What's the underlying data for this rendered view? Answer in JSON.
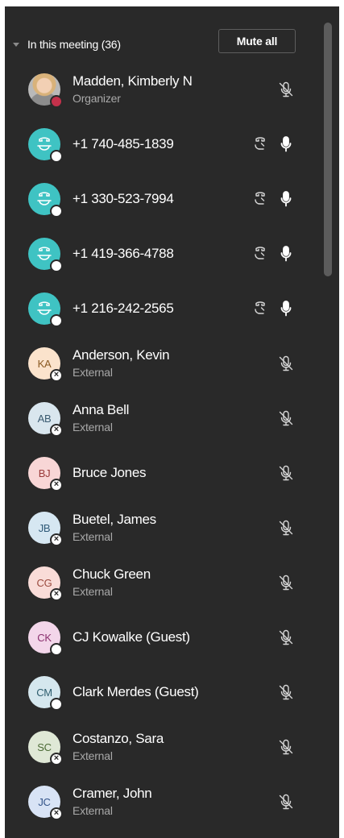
{
  "section": {
    "title": "In this meeting (36)",
    "mute_all_label": "Mute all"
  },
  "participants": [
    {
      "name": "Madden, Kimberly N",
      "subtitle": "Organizer",
      "initials": "",
      "avatar": "photo",
      "avatar_bg": "#b9b9b9",
      "avatar_fg": "#ffffff",
      "status": "busy",
      "mic": "mic-off-icon",
      "phone_icon": false
    },
    {
      "name": "+1 740-485-1839",
      "subtitle": "",
      "initials": "",
      "avatar": "phone",
      "avatar_bg": "#3fc3c3",
      "avatar_fg": "#ffffff",
      "status": "offline",
      "mic": "mic-on-icon",
      "phone_icon": true
    },
    {
      "name": "+1 330-523-7994",
      "subtitle": "",
      "initials": "",
      "avatar": "phone",
      "avatar_bg": "#3fc3c3",
      "avatar_fg": "#ffffff",
      "status": "offline",
      "mic": "mic-on-icon",
      "phone_icon": true
    },
    {
      "name": "+1 419-366-4788",
      "subtitle": "",
      "initials": "",
      "avatar": "phone",
      "avatar_bg": "#3fc3c3",
      "avatar_fg": "#ffffff",
      "status": "offline",
      "mic": "mic-on-icon",
      "phone_icon": true
    },
    {
      "name": "+1 216-242-2565",
      "subtitle": "",
      "initials": "",
      "avatar": "phone",
      "avatar_bg": "#3fc3c3",
      "avatar_fg": "#ffffff",
      "status": "offline",
      "mic": "mic-on-icon",
      "phone_icon": true
    },
    {
      "name": "Anderson, Kevin",
      "subtitle": "External",
      "initials": "KA",
      "avatar": "initials",
      "avatar_bg": "#fbe3cc",
      "avatar_fg": "#8a5a22",
      "status": "external",
      "mic": "mic-off-icon",
      "phone_icon": false
    },
    {
      "name": "Anna Bell",
      "subtitle": "External",
      "initials": "AB",
      "avatar": "initials",
      "avatar_bg": "#d9e6ee",
      "avatar_fg": "#3a5a70",
      "status": "external",
      "mic": "mic-off-icon",
      "phone_icon": false
    },
    {
      "name": "Bruce Jones",
      "subtitle": "",
      "initials": "BJ",
      "avatar": "initials",
      "avatar_bg": "#f8d6d6",
      "avatar_fg": "#9a3b3b",
      "status": "external",
      "mic": "mic-off-icon",
      "phone_icon": false
    },
    {
      "name": "Buetel, James",
      "subtitle": "External",
      "initials": "JB",
      "avatar": "initials",
      "avatar_bg": "#d6e7f2",
      "avatar_fg": "#2f5a78",
      "status": "external",
      "mic": "mic-off-icon",
      "phone_icon": false
    },
    {
      "name": "Chuck Green",
      "subtitle": "External",
      "initials": "CG",
      "avatar": "initials",
      "avatar_bg": "#f9dcd8",
      "avatar_fg": "#9a4a3e",
      "status": "external",
      "mic": "mic-off-icon",
      "phone_icon": false
    },
    {
      "name": "CJ Kowalke (Guest)",
      "subtitle": "",
      "initials": "CK",
      "avatar": "initials",
      "avatar_bg": "#f3d6ea",
      "avatar_fg": "#8a2f6e",
      "status": "offline",
      "mic": "mic-off-icon",
      "phone_icon": false
    },
    {
      "name": "Clark Merdes (Guest)",
      "subtitle": "",
      "initials": "CM",
      "avatar": "initials",
      "avatar_bg": "#d5e7ee",
      "avatar_fg": "#2e5d6e",
      "status": "offline",
      "mic": "mic-off-icon",
      "phone_icon": false
    },
    {
      "name": "Costanzo, Sara",
      "subtitle": "External",
      "initials": "SC",
      "avatar": "initials",
      "avatar_bg": "#dfe8d6",
      "avatar_fg": "#4b6a35",
      "status": "external",
      "mic": "mic-off-icon",
      "phone_icon": false
    },
    {
      "name": "Cramer, John",
      "subtitle": "External",
      "initials": "JC",
      "avatar": "initials",
      "avatar_bg": "#d8e3f5",
      "avatar_fg": "#34558a",
      "status": "external",
      "mic": "mic-off-icon",
      "phone_icon": false
    }
  ]
}
